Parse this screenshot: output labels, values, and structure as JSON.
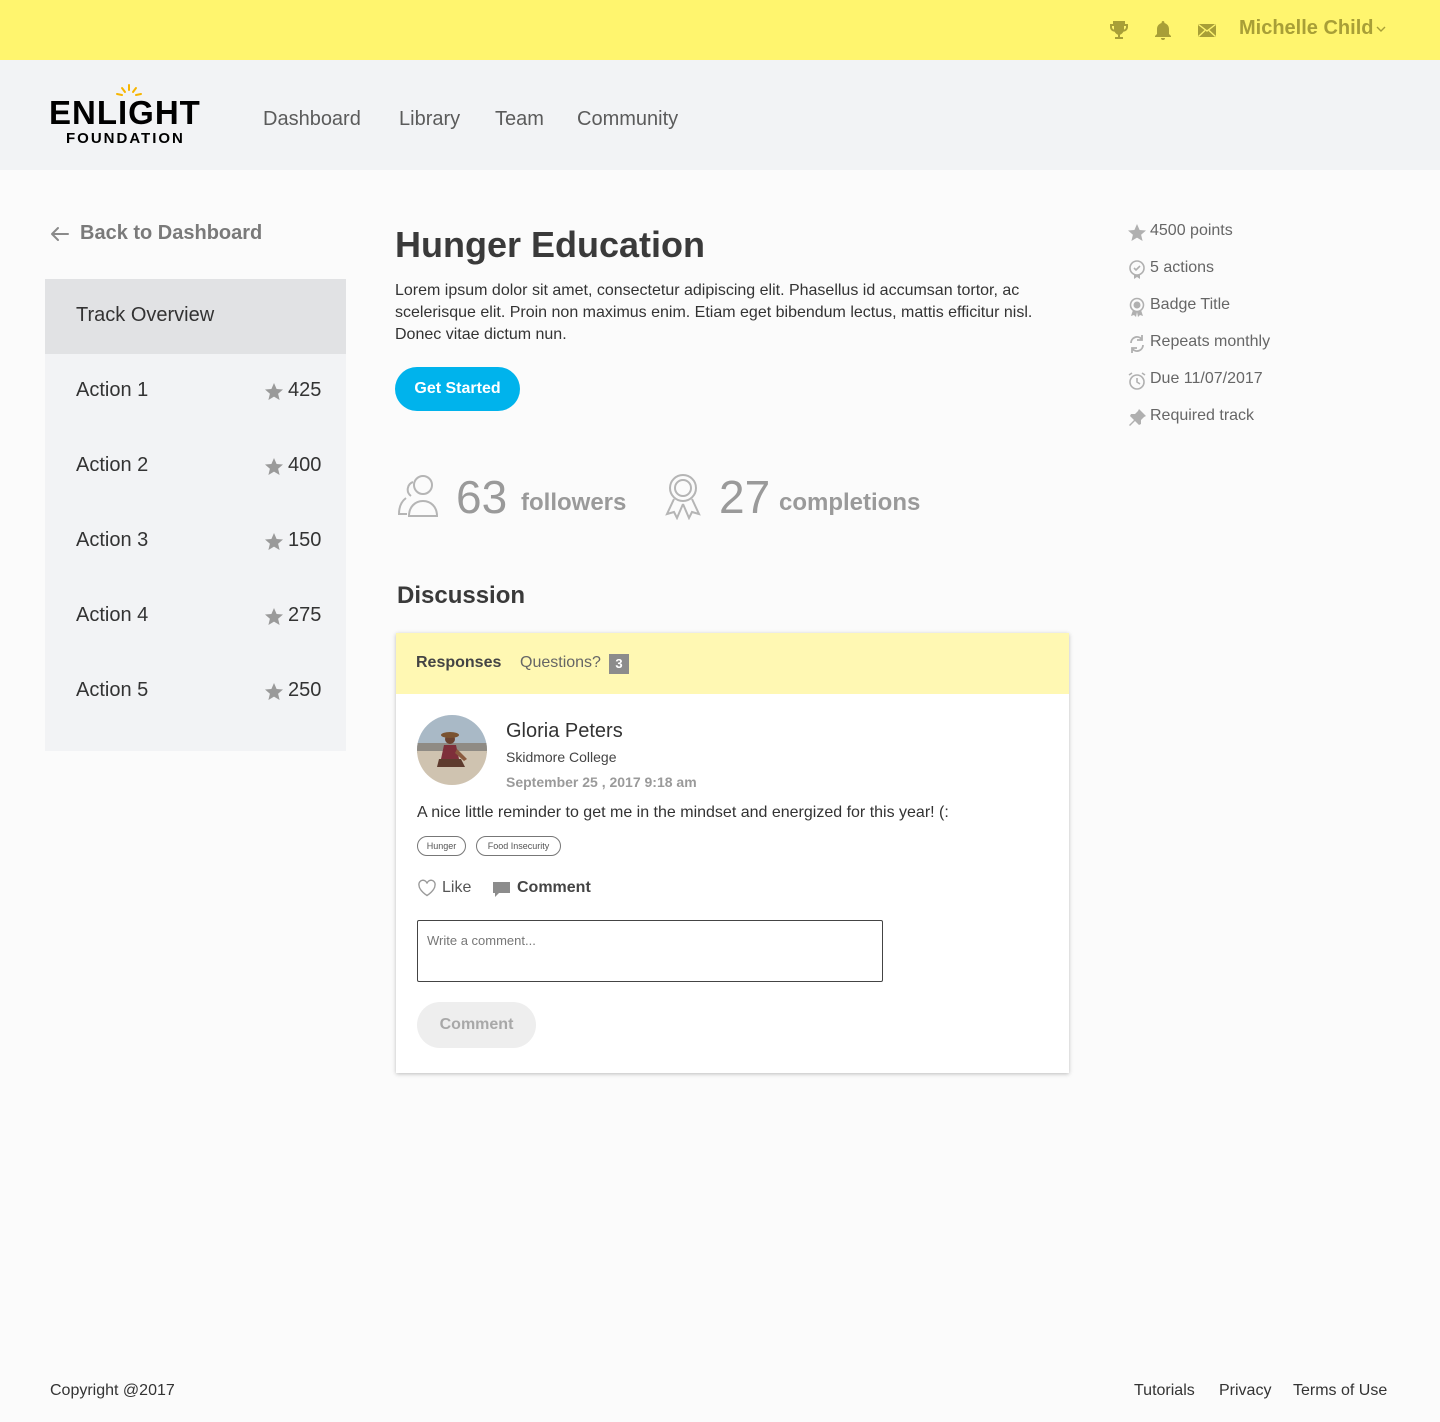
{
  "topbar": {
    "user_name": "Michelle Child",
    "icons": [
      "trophy-icon",
      "bell-icon",
      "mail-icon",
      "chevron-down-icon"
    ]
  },
  "nav": {
    "logo_line1": "ENLIGHT",
    "logo_line2": "FOUNDATION",
    "links": [
      "Dashboard",
      "Library",
      "Team",
      "Community"
    ]
  },
  "sidebar": {
    "back_label": "Back to Dashboard",
    "overview_label": "Track Overview",
    "actions": [
      {
        "label": "Action 1",
        "points": "425"
      },
      {
        "label": "Action 2",
        "points": "400"
      },
      {
        "label": "Action 3",
        "points": "150"
      },
      {
        "label": "Action 4",
        "points": "275"
      },
      {
        "label": "Action 5",
        "points": "250"
      }
    ]
  },
  "main": {
    "title": "Hunger Education",
    "description": "Lorem ipsum dolor sit amet, consectetur adipiscing elit. Phasellus id accumsan tortor, ac scelerisque elit. Proin non maximus enim. Etiam eget bibendum lectus, mattis efficitur nisl. Donec vitae dictum nun.",
    "cta_label": "Get Started",
    "stats": {
      "followers_count": "63",
      "followers_label": "followers",
      "completions_count": "27",
      "completions_label": "completions"
    }
  },
  "discussion": {
    "title": "Discussion",
    "tabs": {
      "responses": "Responses",
      "questions": "Questions?",
      "questions_count": "3"
    },
    "post": {
      "author": "Gloria Peters",
      "college": "Skidmore College",
      "date": "September 25 , 2017 9:18 am",
      "text": "A nice little reminder to get me in the mindset and energized for this year! (:",
      "tags": [
        "Hunger",
        "Food Insecurity"
      ],
      "like_label": "Like",
      "comment_label": "Comment"
    },
    "comment_placeholder": "Write a comment...",
    "comment_submit_label": "Comment"
  },
  "meta": {
    "points": "4500 points",
    "actions": "5 actions",
    "badge": "Badge Title",
    "repeats": "Repeats monthly",
    "due": "Due 11/07/2017",
    "required": "Required track"
  },
  "footer": {
    "copyright": "Copyright @2017",
    "links": [
      "Tutorials",
      "Privacy",
      "Terms of Use"
    ]
  },
  "colors": {
    "topbar_bg": "#fff56e",
    "accent_blue": "#00b3ec",
    "tabs_bg": "#fff8b3",
    "nav_bg": "#f2f3f5"
  }
}
